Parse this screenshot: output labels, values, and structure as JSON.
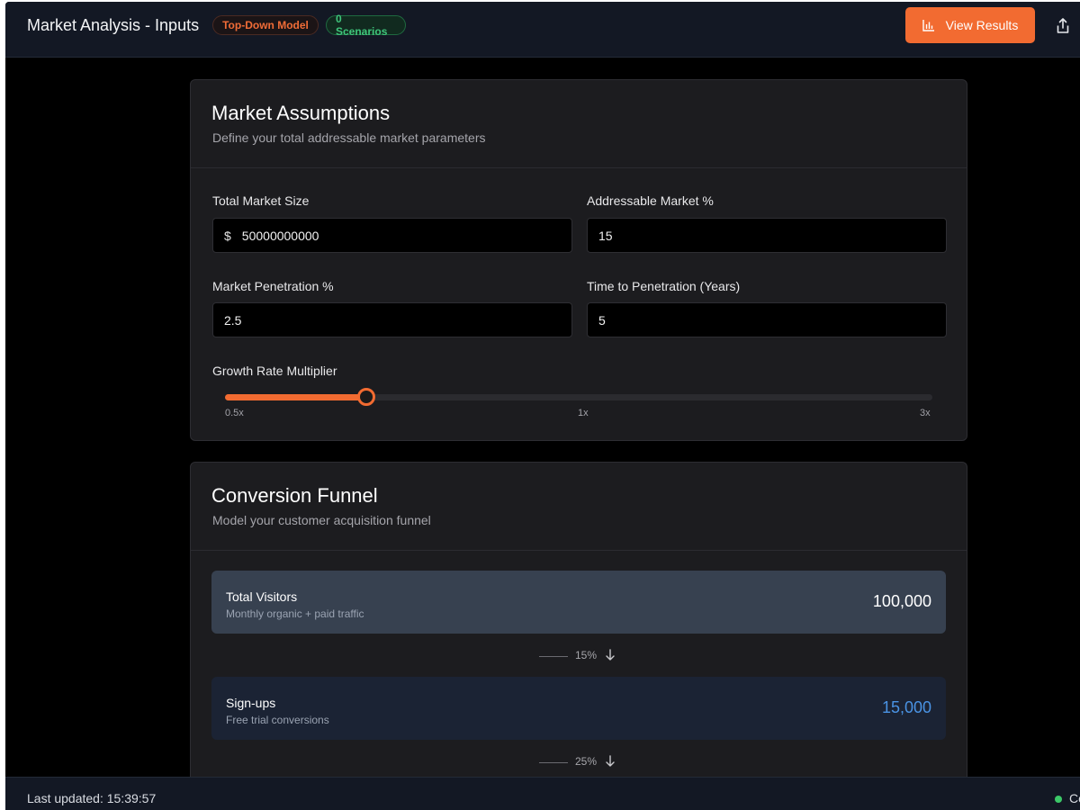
{
  "header": {
    "title": "Market Analysis - Inputs",
    "badge_model": "Top-Down Model",
    "badge_scenarios": "0 Scenarios",
    "view_results_label": "View Results"
  },
  "market": {
    "title": "Market Assumptions",
    "subtitle": "Define your total addressable market parameters",
    "total_market_label": "Total Market Size",
    "currency_prefix": "$",
    "total_market_value": "50000000000",
    "addressable_label": "Addressable Market %",
    "addressable_value": "15",
    "penetration_label": "Market Penetration %",
    "penetration_value": "2.5",
    "time_label": "Time to Penetration (Years)",
    "time_value": "5",
    "growth_label": "Growth Rate Multiplier",
    "growth_fraction": 0.2,
    "growth_min": "0.5x",
    "growth_mid": "1x",
    "growth_max": "3x"
  },
  "funnel": {
    "title": "Conversion Funnel",
    "subtitle": "Model your customer acquisition funnel",
    "stages": [
      {
        "title": "Total Visitors",
        "desc": "Monthly organic + paid traffic",
        "value": "100,000"
      },
      {
        "title": "Sign-ups",
        "desc": "Free trial conversions",
        "value": "15,000"
      }
    ],
    "rates": [
      "15%",
      "25%"
    ]
  },
  "status": {
    "last_updated": "Last updated: 15:39:57",
    "connection": "Co"
  },
  "colors": {
    "accent": "#f26b31",
    "badge_green": "#3fc47b",
    "signups_value": "#4a93e4"
  }
}
